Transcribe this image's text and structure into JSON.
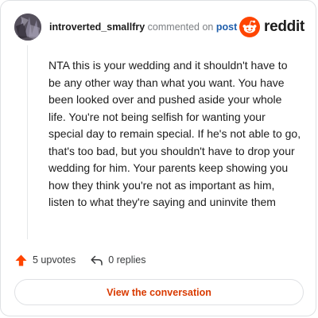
{
  "header": {
    "username": "introverted_smallfry",
    "action_text": "commented on",
    "post_link": "post",
    "avatar_icon": "user-avatar-icon"
  },
  "brand": {
    "logo_icon": "reddit-alien-icon",
    "wordmark": "reddit",
    "color": "#ff4500"
  },
  "comment": {
    "body": "NTA this is your wedding and it shouldn't have to be any other way than what you want. You have been looked over and pushed aside your whole life. You're not being selfish for wanting your special day to remain special. If he's not able to go, that's too bad, but you shouldn't have to drop your wedding for him. Your parents keep showing you how they think you're not as important as him, listen to what they're saying and uninvite them"
  },
  "actions": {
    "upvotes_label": "5 upvotes",
    "upvote_icon": "upvote-arrow-icon",
    "upvote_color": "#ff4500",
    "replies_label": "0 replies",
    "reply_icon": "reply-arrow-icon"
  },
  "cta": {
    "label": "View the conversation",
    "color": "#d93a00"
  }
}
